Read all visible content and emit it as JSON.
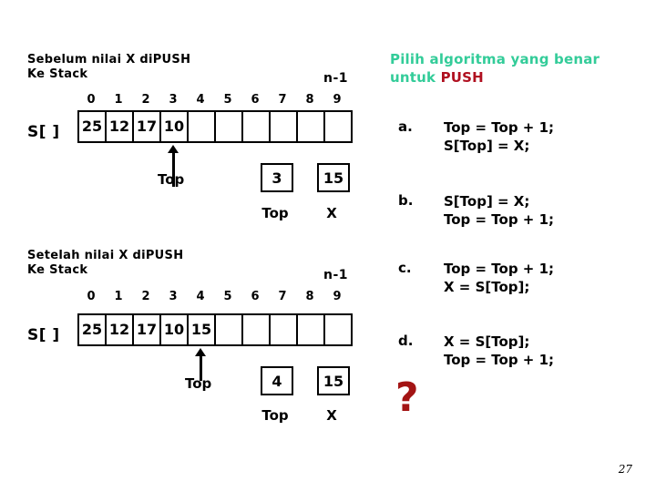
{
  "slide": {
    "page_number": "27",
    "accent_color": "#33CC99",
    "highlight_color": "#B01020",
    "question_mark_color": "#A31414",
    "question_mark": "?"
  },
  "before": {
    "title_line1": "Sebelum nilai X diPUSH",
    "title_line2": "Ke Stack",
    "n_label": "n-1",
    "array_label": "S[ ]",
    "indices": [
      "0",
      "1",
      "2",
      "3",
      "4",
      "5",
      "6",
      "7",
      "8",
      "9"
    ],
    "cells": [
      "25",
      "12",
      "17",
      "10",
      "",
      "",
      "",
      "",
      "",
      ""
    ],
    "pointer_label": "Top",
    "pointer_index": 3,
    "top_box": {
      "value": "3",
      "caption": "Top"
    },
    "x_box": {
      "value": "15",
      "caption": "X"
    }
  },
  "after": {
    "title_line1": "Setelah nilai X diPUSH",
    "title_line2": "Ke Stack",
    "n_label": "n-1",
    "array_label": "S[ ]",
    "indices": [
      "0",
      "1",
      "2",
      "3",
      "4",
      "5",
      "6",
      "7",
      "8",
      "9"
    ],
    "cells": [
      "25",
      "12",
      "17",
      "10",
      "15",
      "",
      "",
      "",
      "",
      ""
    ],
    "pointer_label": "Top",
    "pointer_index": 4,
    "top_box": {
      "value": "4",
      "caption": "Top"
    },
    "x_box": {
      "value": "15",
      "caption": "X"
    }
  },
  "question": {
    "heading_part1": "Pilih algoritma yang benar",
    "heading_part2": "untuk  ",
    "heading_highlight": "PUSH",
    "options": [
      {
        "letter": "a.",
        "line1": "Top = Top + 1;",
        "line2": "S[Top] = X;"
      },
      {
        "letter": "b.",
        "line1": "S[Top] = X;",
        "line2": "Top = Top + 1;"
      },
      {
        "letter": "c.",
        "line1": "Top = Top + 1;",
        "line2": "X = S[Top];"
      },
      {
        "letter": "d.",
        "line1": "X = S[Top];",
        "line2": "Top = Top + 1;"
      }
    ]
  }
}
